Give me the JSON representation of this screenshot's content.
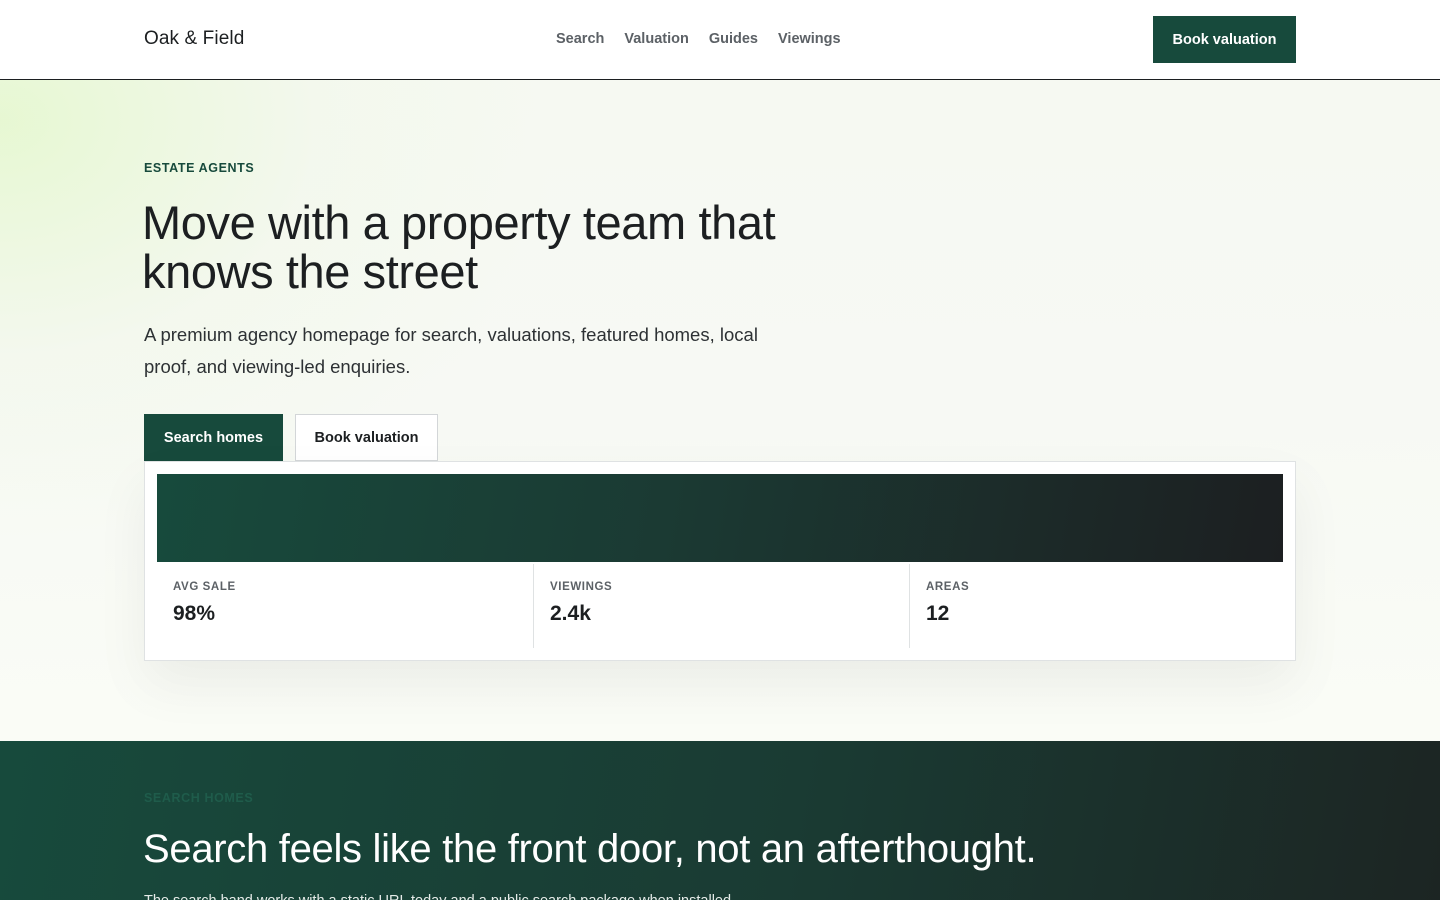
{
  "header": {
    "brand": "Oak & Field",
    "nav": [
      "Search",
      "Valuation",
      "Guides",
      "Viewings"
    ],
    "cta_label": "Book valuation"
  },
  "hero": {
    "eyebrow": "ESTATE AGENTS",
    "title": "Move with a property team that knows the street",
    "subtitle": "A premium agency homepage for search, valuations, featured homes, local proof, and viewing-led enquiries.",
    "primary_button": "Search homes",
    "secondary_button": "Book valuation",
    "stats": [
      {
        "label": "AVG SALE",
        "value": "98%"
      },
      {
        "label": "VIEWINGS",
        "value": "2.4k"
      },
      {
        "label": "AREAS",
        "value": "12"
      }
    ]
  },
  "search_section": {
    "eyebrow": "SEARCH HOMES",
    "title": "Search feels like the front door, not an afterthought.",
    "subtitle": "The search band works with a static URL today and a public search package when installed."
  },
  "colors": {
    "brand_green": "#174a3c",
    "ink": "#1c1f21",
    "muted": "#5c6166"
  }
}
